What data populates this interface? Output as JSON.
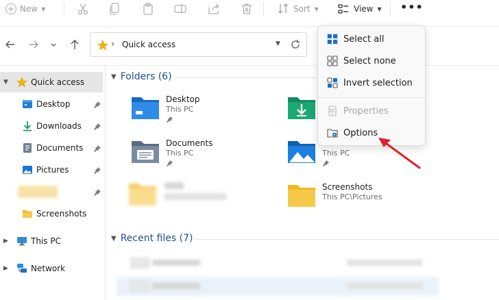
{
  "toolbar": {
    "new_label": "New",
    "sort_label": "Sort",
    "view_label": "View",
    "more_label": "•••",
    "icons": [
      "cut-icon",
      "copy-icon",
      "paste-icon",
      "rename-icon",
      "share-icon",
      "delete-icon"
    ]
  },
  "address": {
    "path_label": "Quick access"
  },
  "sidebar": {
    "items": [
      {
        "label": "Quick access",
        "icon": "star-icon"
      },
      {
        "label": "Desktop",
        "icon": "desktop-folder-icon",
        "pinned": true
      },
      {
        "label": "Downloads",
        "icon": "download-icon",
        "pinned": true
      },
      {
        "label": "Documents",
        "icon": "documents-icon",
        "pinned": true
      },
      {
        "label": "Pictures",
        "icon": "pictures-icon",
        "pinned": true
      },
      {
        "label": "",
        "icon": "folder-icon",
        "pinned": true
      },
      {
        "label": "Screenshots",
        "icon": "folder-icon"
      },
      {
        "label": "This PC",
        "icon": "monitor-icon"
      },
      {
        "label": "Network",
        "icon": "network-icon"
      }
    ]
  },
  "main": {
    "folders_header": "Folders (6)",
    "recent_header": "Recent files (7)",
    "folders": [
      {
        "name": "Desktop",
        "location": "This PC",
        "pinned": true
      },
      {
        "name": "",
        "location": "",
        "pinned": false
      },
      {
        "name": "Documents",
        "location": "This PC",
        "pinned": true
      },
      {
        "name": "",
        "location": "This PC",
        "pinned": true
      },
      {
        "name": "",
        "location": "",
        "pinned": false
      },
      {
        "name": "Screenshots",
        "location": "This PC\\Pictures",
        "pinned": false
      }
    ]
  },
  "menu": {
    "items": [
      {
        "label": "Select all",
        "icon": "select-all-icon",
        "enabled": true
      },
      {
        "label": "Select none",
        "icon": "select-none-icon",
        "enabled": true
      },
      {
        "label": "Invert selection",
        "icon": "invert-selection-icon",
        "enabled": true
      },
      {
        "label": "Properties",
        "icon": "properties-icon",
        "enabled": false
      },
      {
        "label": "Options",
        "icon": "options-icon",
        "enabled": true
      }
    ]
  },
  "colors": {
    "accent": "#0067c0",
    "folder_yellow": "#f7c948",
    "annotation_red": "#e0202a"
  }
}
